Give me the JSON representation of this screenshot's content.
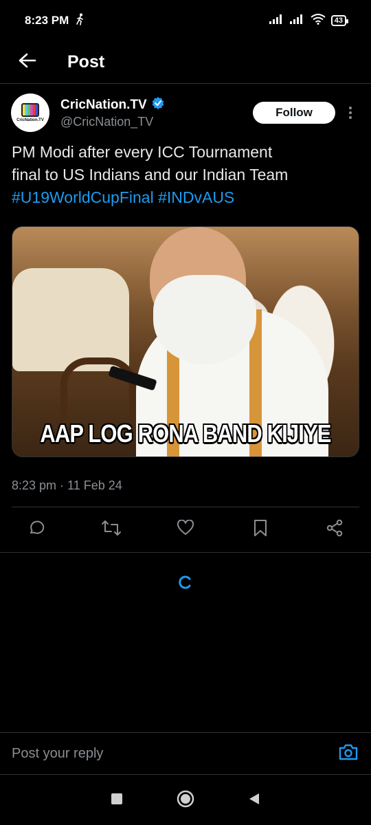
{
  "status_bar": {
    "time": "8:23 PM",
    "battery": "43"
  },
  "header": {
    "title": "Post"
  },
  "post": {
    "author": {
      "display_name": "CricNation.TV",
      "handle": "@CricNation_TV",
      "avatar_brand": "CricNation.TV",
      "verified": true
    },
    "follow_label": "Follow",
    "text_line1": "PM Modi after every ICC Tournament",
    "text_line2": "final to US Indians and our Indian Team",
    "hashtag1": "#U19WorldCupFinal",
    "hashtag2": "#INDvAUS",
    "media_caption": "AAP LOG RONA BAND KIJIYE",
    "timestamp": "8:23 pm · 11 Feb 24"
  },
  "actions": [
    "reply-icon",
    "repost-icon",
    "like-icon",
    "bookmark-icon",
    "share-icon"
  ],
  "reply": {
    "placeholder": "Post your reply"
  },
  "colors": {
    "background": "#000000",
    "accent": "#1d9bf0",
    "secondary_text": "#8b8f94",
    "divider": "#2f3336"
  }
}
